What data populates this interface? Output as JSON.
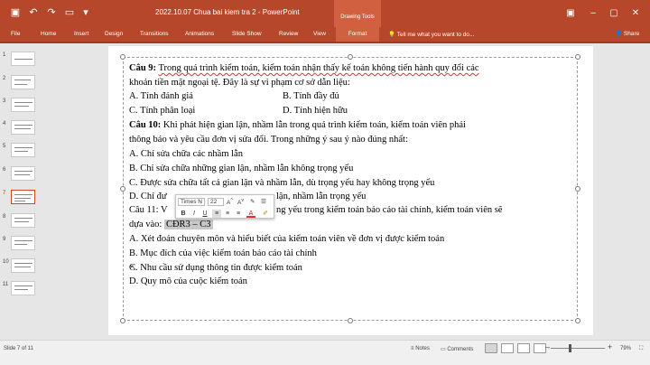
{
  "titlebar": {
    "doc_title": "2022.10.07 Chua bai kiem tra 2 - PowerPoint",
    "drawing_tools": "Drawing Tools"
  },
  "ribbon": {
    "tabs": [
      "File",
      "Home",
      "Insert",
      "Design",
      "Transitions",
      "Animations",
      "Slide Show",
      "Review",
      "View"
    ],
    "format": "Format",
    "tell_me": "Tell me what you want to do...",
    "share": "Share"
  },
  "thumbnails": {
    "numbers": [
      "1",
      "2",
      "3",
      "4",
      "5",
      "6",
      "7",
      "8",
      "9",
      "10",
      "11"
    ],
    "selected": "7"
  },
  "slide": {
    "q9_label": "Câu 9:",
    "q9_line1": "Trong quá trình kiểm toán, kiểm toán nhận thấy kế toán không tiến hành quy đổi các",
    "q9_line2": "khoản tiền mặt ngoại tệ. Đây là sự vi phạm cơ sở dẫn liệu:",
    "q9_a": "A. Tính đánh giá",
    "q9_b": "B. Tính đầy đủ",
    "q9_c": "C. Tính phân loại",
    "q9_d": "D. Tính hiện hữu",
    "q10_label": "Câu 10:",
    "q10_line1": "Khi phát hiện gian lận, nhầm lẫn trong quá trình kiểm toán, kiểm toán viên phải",
    "q10_line2": "thông báo và yêu cầu đơn vị sửa đổi. Trong những ý sau ý nào đúng nhất:",
    "q10_a": "A. Chỉ sửa chữa các nhầm lẫn",
    "q10_b": "B. Chỉ sửa chữa những gian lận, nhầm lẫn không trọng yếu",
    "q10_c": "C. Được sửa chữa tất cả gian lận và nhầm lẫn, dù trọng yếu hay không trọng yếu",
    "q10_d_start": "D. Chỉ đư",
    "q10_d_end": "lận, nhầm lẫn trọng yếu",
    "q11_label": "Câu 11:",
    "q11_label_visible": "Câu 11: V",
    "q11_line1_end": "ng yếu trong kiểm toán báo cáo tài chính, kiểm toán viên sẽ",
    "q11_line2": "dựa vào:",
    "q11_highlight": "CĐR3 – C3",
    "q11_a": "A. Xét đoán chuyên môn và hiểu biết của kiểm toán viên về đơn vị được kiểm toán",
    "q11_b": "B. Mục đích của việc kiểm toán báo cáo tài chính",
    "q11_c": "C. Nhu cầu sử dụng thông tin được kiểm toán",
    "q11_d": "D. Quy mô của cuộc kiểm toán"
  },
  "mini_toolbar": {
    "font": "Times N",
    "size": "22",
    "bold": "B",
    "italic": "I",
    "underline": "U",
    "font_color": "A"
  },
  "status": {
    "slide_info": "Slide 7 of 11",
    "notes": "Notes",
    "comments": "Comments",
    "zoom": "79%"
  },
  "colors": {
    "accent": "#b7472a",
    "contextual": "#d0603f",
    "spell": "#e03030"
  }
}
